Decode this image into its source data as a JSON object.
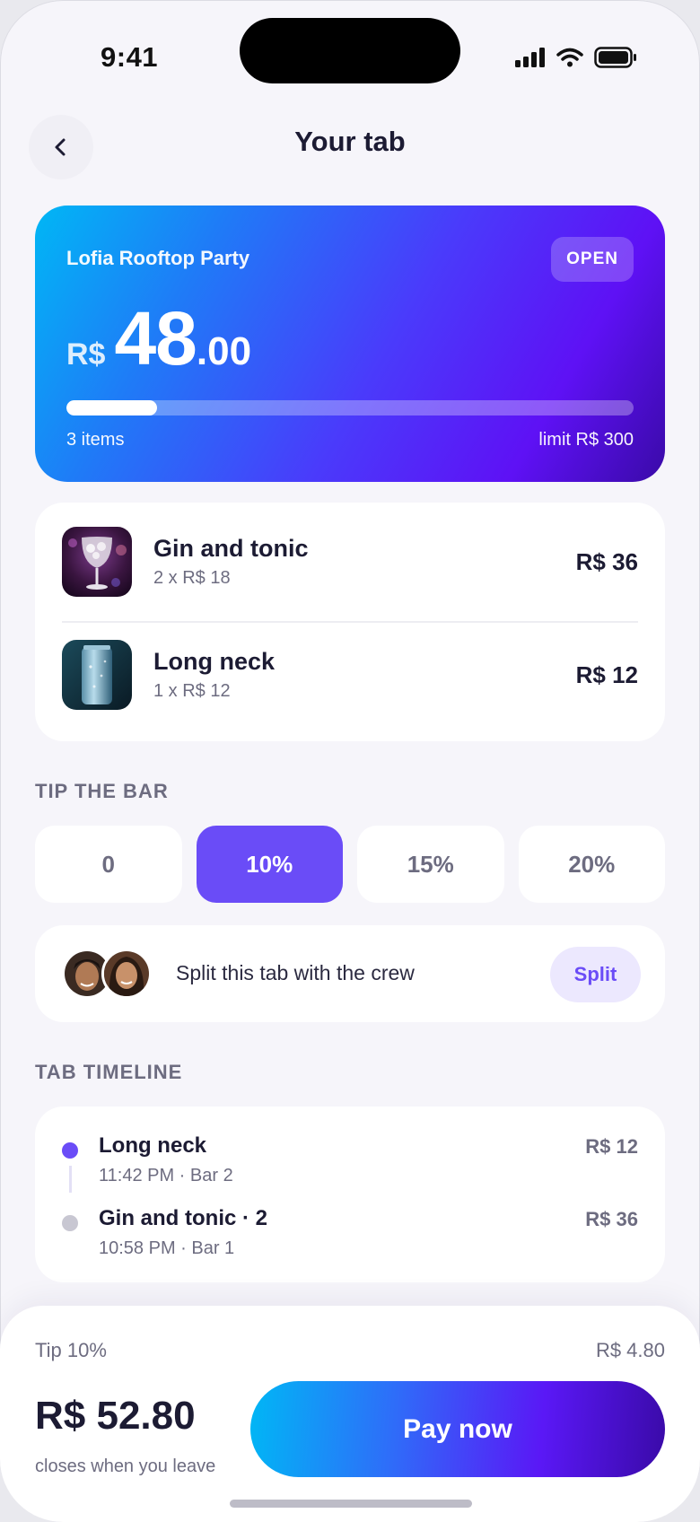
{
  "status_bar": {
    "time": "9:41"
  },
  "header": {
    "title": "Your tab",
    "back_icon": "chevron-left-icon"
  },
  "hero": {
    "venue": "Lofia Rooftop Party",
    "badge": "OPEN",
    "currency": "R$",
    "amount_int": "48",
    "amount_dec": ".00",
    "progress_fraction": 0.16,
    "items_count": "3 items",
    "limit": "limit R$ 300",
    "gradient": [
      "#00b7f5",
      "#5e11f5",
      "#3a0aa8"
    ]
  },
  "items": [
    {
      "name": "Gin and tonic",
      "sub": "2 x R$ 18",
      "price": "R$ 36",
      "thumb": "gin-glass"
    },
    {
      "name": "Long neck",
      "sub": "1 x R$ 12",
      "price": "R$ 12",
      "thumb": "beer-can"
    }
  ],
  "tip": {
    "label": "TIP THE BAR",
    "options": [
      "0",
      "10%",
      "15%",
      "20%"
    ],
    "selected": "10%",
    "accent": "#6a4cf7"
  },
  "split": {
    "text": "Split this tab with the crew",
    "button": "Split"
  },
  "timeline": {
    "label": "TAB TIMELINE",
    "entries": [
      {
        "name": "Long neck",
        "sub": "11:42 PM · Bar 2",
        "price": "R$ 12",
        "active": true
      },
      {
        "name": "Gin and tonic · 2",
        "sub": "10:58 PM · Bar 1",
        "price": "R$ 36",
        "active": false
      }
    ]
  },
  "footer": {
    "tip_label": "Tip 10%",
    "tip_value": "R$ 4.80",
    "total": "R$ 52.80",
    "note": "closes when you leave",
    "pay_button": "Pay now"
  }
}
